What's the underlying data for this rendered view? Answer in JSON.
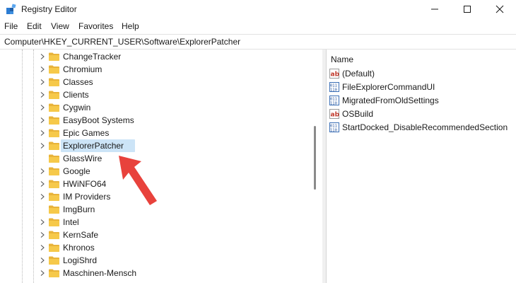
{
  "window": {
    "title": "Registry Editor"
  },
  "menu": [
    "File",
    "Edit",
    "View",
    "Favorites",
    "Help"
  ],
  "address": "Computer\\HKEY_CURRENT_USER\\Software\\ExplorerPatcher",
  "tree": {
    "items": [
      {
        "label": "ChangeTracker",
        "expandable": true
      },
      {
        "label": "Chromium",
        "expandable": true
      },
      {
        "label": "Classes",
        "expandable": true
      },
      {
        "label": "Clients",
        "expandable": true
      },
      {
        "label": "Cygwin",
        "expandable": true
      },
      {
        "label": "EasyBoot Systems",
        "expandable": true
      },
      {
        "label": "Epic Games",
        "expandable": true
      },
      {
        "label": "ExplorerPatcher",
        "expandable": true,
        "selected": true
      },
      {
        "label": "GlassWire",
        "expandable": false
      },
      {
        "label": "Google",
        "expandable": true
      },
      {
        "label": "HWiNFO64",
        "expandable": true
      },
      {
        "label": "IM Providers",
        "expandable": true
      },
      {
        "label": "ImgBurn",
        "expandable": false
      },
      {
        "label": "Intel",
        "expandable": true
      },
      {
        "label": "KernSafe",
        "expandable": true
      },
      {
        "label": "Khronos",
        "expandable": true
      },
      {
        "label": "LogiShrd",
        "expandable": true
      },
      {
        "label": "Maschinen-Mensch",
        "expandable": true
      }
    ]
  },
  "values": {
    "column_name": "Name",
    "rows": [
      {
        "name": "(Default)",
        "icon": "string-value-icon"
      },
      {
        "name": "FileExplorerCommandUI",
        "icon": "dword-value-icon"
      },
      {
        "name": "MigratedFromOldSettings",
        "icon": "dword-value-icon"
      },
      {
        "name": "OSBuild",
        "icon": "string-value-icon"
      },
      {
        "name": "StartDocked_DisableRecommendedSection",
        "icon": "dword-value-icon"
      }
    ]
  },
  "colors": {
    "selection": "#cce4f7",
    "folder": "#f6c94a",
    "arrow": "#e8423c"
  }
}
